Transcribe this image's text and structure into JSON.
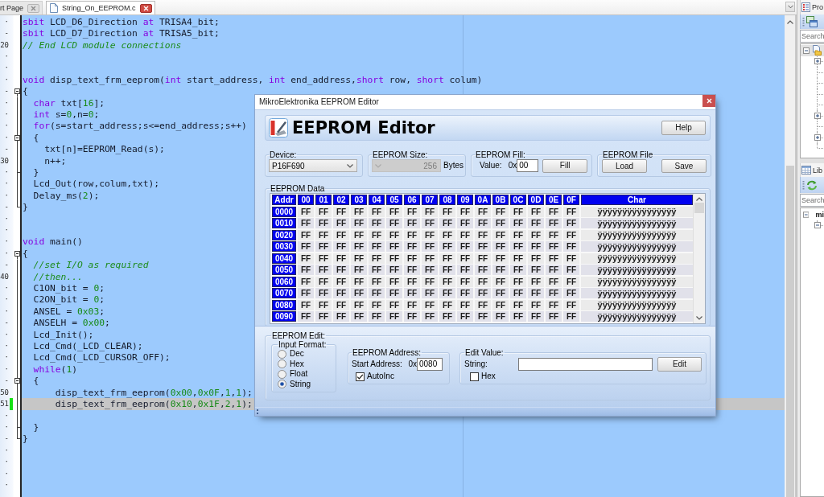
{
  "editor_tabs": [
    {
      "kind": "page",
      "label": "rt Page",
      "selected": false
    },
    {
      "kind": "file",
      "label": "String_On_EEPROM.c",
      "selected": true
    }
  ],
  "editor": {
    "lines": [
      {
        "kind": "plain",
        "gutter": "·",
        "current": false,
        "modified": false,
        "tokens": [
          {
            "kind": "keyword",
            "text": "sbit"
          },
          {
            "kind": "plain",
            "text": " LCD_D6_Direction "
          },
          {
            "kind": "keyword",
            "text": "at"
          },
          {
            "kind": "plain",
            "text": " TRISA4_bit;"
          }
        ]
      },
      {
        "kind": "plain",
        "gutter": "-",
        "current": false,
        "modified": false,
        "tokens": [
          {
            "kind": "keyword",
            "text": "sbit"
          },
          {
            "kind": "plain",
            "text": " LCD_D7_Direction "
          },
          {
            "kind": "keyword",
            "text": "at"
          },
          {
            "kind": "plain",
            "text": " TRISA5_bit;"
          }
        ]
      },
      {
        "kind": "plain",
        "gutter": "20",
        "current": false,
        "modified": false,
        "tokens": [
          {
            "kind": "comment",
            "text": "// End LCD module connections"
          }
        ]
      },
      {
        "kind": "plain",
        "gutter": "·",
        "current": false,
        "modified": false
      },
      {
        "kind": "plain",
        "gutter": "·",
        "current": false,
        "modified": false
      },
      {
        "kind": "plain",
        "gutter": "·",
        "current": false,
        "modified": false,
        "tokens": [
          {
            "kind": "keyword",
            "text": "void"
          },
          {
            "kind": "plain",
            "text": " disp_text_frm_eeprom("
          },
          {
            "kind": "keyword",
            "text": "int"
          },
          {
            "kind": "plain",
            "text": " start_address, "
          },
          {
            "kind": "keyword",
            "text": "int"
          },
          {
            "kind": "plain",
            "text": " end_address,"
          },
          {
            "kind": "keyword",
            "text": "short"
          },
          {
            "kind": "plain",
            "text": " row, "
          },
          {
            "kind": "keyword",
            "text": "short"
          },
          {
            "kind": "plain",
            "text": " colum)"
          }
        ]
      },
      {
        "kind": "fold_start",
        "gutter": "-",
        "current": false,
        "modified": false,
        "tokens": [
          {
            "kind": "plain",
            "text": "{"
          }
        ]
      },
      {
        "kind": "fold_body",
        "gutter": "·",
        "current": false,
        "modified": false,
        "tokens": [
          {
            "kind": "keyword",
            "text": "  char"
          },
          {
            "kind": "plain",
            "text": " txt["
          },
          {
            "kind": "number",
            "text": "16"
          },
          {
            "kind": "plain",
            "text": "];"
          }
        ]
      },
      {
        "kind": "fold_body",
        "gutter": "·",
        "current": false,
        "modified": false,
        "tokens": [
          {
            "kind": "keyword",
            "text": "  int"
          },
          {
            "kind": "plain",
            "text": " s="
          },
          {
            "kind": "number",
            "text": "0"
          },
          {
            "kind": "plain",
            "text": ",n="
          },
          {
            "kind": "number",
            "text": "0"
          },
          {
            "kind": "plain",
            "text": ";"
          }
        ]
      },
      {
        "kind": "fold_body",
        "gutter": "·",
        "current": false,
        "modified": false,
        "tokens": [
          {
            "kind": "keyword",
            "text": "  for"
          },
          {
            "kind": "plain",
            "text": "(s=start_address;s<=end_address;s++)"
          }
        ]
      },
      {
        "kind": "fold_start",
        "gutter": "·",
        "current": false,
        "modified": false,
        "tokens": [
          {
            "kind": "plain",
            "text": "  {"
          }
        ]
      },
      {
        "kind": "fold_body",
        "gutter": "-",
        "current": false,
        "modified": false,
        "tokens": [
          {
            "kind": "plain",
            "text": "    txt[n]=EEPROM_Read(s);"
          }
        ]
      },
      {
        "kind": "fold_body",
        "gutter": "30",
        "current": false,
        "modified": false,
        "tokens": [
          {
            "kind": "plain",
            "text": "    n++;"
          }
        ]
      },
      {
        "kind": "fold_branch",
        "gutter": "·",
        "current": false,
        "modified": false,
        "tokens": [
          {
            "kind": "plain",
            "text": "  }"
          }
        ]
      },
      {
        "kind": "fold_body",
        "gutter": "·",
        "current": false,
        "modified": false,
        "tokens": [
          {
            "kind": "plain",
            "text": "  Lcd_Out(row,colum,txt);"
          }
        ]
      },
      {
        "kind": "fold_body",
        "gutter": "·",
        "current": false,
        "modified": false,
        "tokens": [
          {
            "kind": "plain",
            "text": "  Delay_ms("
          },
          {
            "kind": "number",
            "text": "2"
          },
          {
            "kind": "plain",
            "text": ");"
          }
        ]
      },
      {
        "kind": "fold_end",
        "gutter": "-",
        "current": false,
        "modified": false,
        "tokens": [
          {
            "kind": "plain",
            "text": "}"
          }
        ]
      },
      {
        "kind": "plain",
        "gutter": "·",
        "current": false,
        "modified": false
      },
      {
        "kind": "plain",
        "gutter": "·",
        "current": false,
        "modified": false
      },
      {
        "kind": "plain",
        "gutter": "·",
        "current": false,
        "modified": false,
        "tokens": [
          {
            "kind": "keyword",
            "text": "void"
          },
          {
            "kind": "plain",
            "text": " main()"
          }
        ]
      },
      {
        "kind": "fold_start",
        "gutter": "·",
        "current": false,
        "modified": false,
        "tokens": [
          {
            "kind": "plain",
            "text": "{"
          }
        ]
      },
      {
        "kind": "fold_body",
        "gutter": "-",
        "current": false,
        "modified": false,
        "tokens": [
          {
            "kind": "comment",
            "text": "  //set I/O as required"
          }
        ]
      },
      {
        "kind": "fold_body",
        "gutter": "40",
        "current": false,
        "modified": false,
        "tokens": [
          {
            "kind": "comment",
            "text": "  //then..."
          }
        ]
      },
      {
        "kind": "fold_body",
        "gutter": "·",
        "current": false,
        "modified": false,
        "tokens": [
          {
            "kind": "plain",
            "text": "  C1ON_bit = "
          },
          {
            "kind": "number",
            "text": "0"
          },
          {
            "kind": "plain",
            "text": ";"
          }
        ]
      },
      {
        "kind": "fold_body",
        "gutter": "·",
        "current": false,
        "modified": false,
        "tokens": [
          {
            "kind": "plain",
            "text": "  C2ON_bit = "
          },
          {
            "kind": "number",
            "text": "0"
          },
          {
            "kind": "plain",
            "text": ";"
          }
        ]
      },
      {
        "kind": "fold_body",
        "gutter": "·",
        "current": false,
        "modified": false,
        "tokens": [
          {
            "kind": "plain",
            "text": "  ANSEL = "
          },
          {
            "kind": "number",
            "text": "0x03"
          },
          {
            "kind": "plain",
            "text": ";"
          }
        ]
      },
      {
        "kind": "fold_body",
        "gutter": "-",
        "current": false,
        "modified": false,
        "tokens": [
          {
            "kind": "plain",
            "text": "  ANSELH = "
          },
          {
            "kind": "number",
            "text": "0x00"
          },
          {
            "kind": "plain",
            "text": ";"
          }
        ]
      },
      {
        "kind": "fold_body",
        "gutter": "·",
        "current": false,
        "modified": false,
        "tokens": [
          {
            "kind": "plain",
            "text": "  Lcd_Init();"
          }
        ]
      },
      {
        "kind": "fold_body",
        "gutter": "·",
        "current": false,
        "modified": false,
        "tokens": [
          {
            "kind": "plain",
            "text": "  Lcd_Cmd(_LCD_CLEAR);"
          }
        ]
      },
      {
        "kind": "fold_body",
        "gutter": "·",
        "current": false,
        "modified": false,
        "tokens": [
          {
            "kind": "plain",
            "text": "  Lcd_Cmd(_LCD_CURSOR_OFF);"
          }
        ]
      },
      {
        "kind": "fold_body",
        "gutter": "·",
        "current": false,
        "modified": false,
        "tokens": [
          {
            "kind": "keyword",
            "text": "  while"
          },
          {
            "kind": "plain",
            "text": "("
          },
          {
            "kind": "number",
            "text": "1"
          },
          {
            "kind": "plain",
            "text": ")"
          }
        ]
      },
      {
        "kind": "fold_start",
        "gutter": "-",
        "current": false,
        "modified": false,
        "tokens": [
          {
            "kind": "plain",
            "text": "  {"
          }
        ]
      },
      {
        "kind": "fold_body",
        "gutter": "50",
        "current": false,
        "modified": false,
        "tokens": [
          {
            "kind": "plain",
            "text": "      disp_text_frm_eeprom("
          },
          {
            "kind": "number",
            "text": "0x00"
          },
          {
            "kind": "plain",
            "text": ","
          },
          {
            "kind": "number",
            "text": "0x0F"
          },
          {
            "kind": "plain",
            "text": ","
          },
          {
            "kind": "number",
            "text": "1"
          },
          {
            "kind": "plain",
            "text": ","
          },
          {
            "kind": "number",
            "text": "1"
          },
          {
            "kind": "plain",
            "text": ");"
          }
        ]
      },
      {
        "kind": "fold_body",
        "gutter": "51",
        "current": true,
        "modified": true,
        "tokens": [
          {
            "kind": "plain",
            "text": "      disp_text_frm_eeprom("
          },
          {
            "kind": "number",
            "text": "0x10"
          },
          {
            "kind": "plain",
            "text": ","
          },
          {
            "kind": "number",
            "text": "0x1F"
          },
          {
            "kind": "plain",
            "text": ","
          },
          {
            "kind": "number",
            "text": "2"
          },
          {
            "kind": "plain",
            "text": ","
          },
          {
            "kind": "number",
            "text": "1"
          },
          {
            "kind": "plain",
            "text": ");"
          }
        ]
      },
      {
        "kind": "fold_body",
        "gutter": "·",
        "current": false,
        "modified": false
      },
      {
        "kind": "fold_branch",
        "gutter": "·",
        "current": false,
        "modified": false,
        "tokens": [
          {
            "kind": "plain",
            "text": "  }"
          }
        ]
      },
      {
        "kind": "fold_end",
        "gutter": "-",
        "current": false,
        "modified": false,
        "tokens": [
          {
            "kind": "plain",
            "text": "}"
          }
        ]
      },
      {
        "kind": "plain",
        "gutter": "·",
        "current": false,
        "modified": false
      },
      {
        "kind": "plain",
        "gutter": "·",
        "current": false,
        "modified": false
      },
      {
        "kind": "plain",
        "gutter": "·",
        "current": false,
        "modified": false
      },
      {
        "kind": "plain",
        "gutter": "·",
        "current": false,
        "modified": false
      }
    ]
  },
  "eeprom_editor": {
    "title": "MikroElektronika EEPROM Editor",
    "heading": "EEPROM Editor",
    "help_button": "Help",
    "device": {
      "label": "Device:",
      "value": "P16F690"
    },
    "eeprom_size": {
      "label": "EEPROM Size:",
      "value": "256",
      "unit": "Bytes",
      "disabled": true
    },
    "eeprom_fill": {
      "label": "EEPROM Fill:",
      "value_label": "Value:",
      "prefix": "0x",
      "value": "00",
      "button": "Fill"
    },
    "eeprom_file": {
      "label": "EEPROM File",
      "buttons": [
        "Load",
        "Save"
      ]
    },
    "eeprom_data": {
      "label": "EEPROM Data",
      "columns": [
        "Addr",
        "00",
        "01",
        "02",
        "03",
        "04",
        "05",
        "06",
        "07",
        "08",
        "09",
        "0A",
        "0B",
        "0C",
        "0D",
        "0E",
        "0F",
        "Char"
      ],
      "rows": [
        {
          "cells": [
            "0000",
            "FF",
            "FF",
            "FF",
            "FF",
            "FF",
            "FF",
            "FF",
            "FF",
            "FF",
            "FF",
            "FF",
            "FF",
            "FF",
            "FF",
            "FF",
            "FF",
            "ÿÿÿÿÿÿÿÿÿÿÿÿÿÿÿÿ"
          ]
        },
        {
          "cells": [
            "0010",
            "FF",
            "FF",
            "FF",
            "FF",
            "FF",
            "FF",
            "FF",
            "FF",
            "FF",
            "FF",
            "FF",
            "FF",
            "FF",
            "FF",
            "FF",
            "FF",
            "ÿÿÿÿÿÿÿÿÿÿÿÿÿÿÿÿ"
          ]
        },
        {
          "cells": [
            "0020",
            "FF",
            "FF",
            "FF",
            "FF",
            "FF",
            "FF",
            "FF",
            "FF",
            "FF",
            "FF",
            "FF",
            "FF",
            "FF",
            "FF",
            "FF",
            "FF",
            "ÿÿÿÿÿÿÿÿÿÿÿÿÿÿÿÿ"
          ]
        },
        {
          "cells": [
            "0030",
            "FF",
            "FF",
            "FF",
            "FF",
            "FF",
            "FF",
            "FF",
            "FF",
            "FF",
            "FF",
            "FF",
            "FF",
            "FF",
            "FF",
            "FF",
            "FF",
            "ÿÿÿÿÿÿÿÿÿÿÿÿÿÿÿÿ"
          ]
        },
        {
          "cells": [
            "0040",
            "FF",
            "FF",
            "FF",
            "FF",
            "FF",
            "FF",
            "FF",
            "FF",
            "FF",
            "FF",
            "FF",
            "FF",
            "FF",
            "FF",
            "FF",
            "FF",
            "ÿÿÿÿÿÿÿÿÿÿÿÿÿÿÿÿ"
          ]
        },
        {
          "cells": [
            "0050",
            "FF",
            "FF",
            "FF",
            "FF",
            "FF",
            "FF",
            "FF",
            "FF",
            "FF",
            "FF",
            "FF",
            "FF",
            "FF",
            "FF",
            "FF",
            "FF",
            "ÿÿÿÿÿÿÿÿÿÿÿÿÿÿÿÿ"
          ]
        },
        {
          "cells": [
            "0060",
            "FF",
            "FF",
            "FF",
            "FF",
            "FF",
            "FF",
            "FF",
            "FF",
            "FF",
            "FF",
            "FF",
            "FF",
            "FF",
            "FF",
            "FF",
            "FF",
            "ÿÿÿÿÿÿÿÿÿÿÿÿÿÿÿÿ"
          ]
        },
        {
          "cells": [
            "0070",
            "FF",
            "FF",
            "FF",
            "FF",
            "FF",
            "FF",
            "FF",
            "FF",
            "FF",
            "FF",
            "FF",
            "FF",
            "FF",
            "FF",
            "FF",
            "FF",
            "ÿÿÿÿÿÿÿÿÿÿÿÿÿÿÿÿ"
          ]
        },
        {
          "cells": [
            "0080",
            "FF",
            "FF",
            "FF",
            "FF",
            "FF",
            "FF",
            "FF",
            "FF",
            "FF",
            "FF",
            "FF",
            "FF",
            "FF",
            "FF",
            "FF",
            "FF",
            "ÿÿÿÿÿÿÿÿÿÿÿÿÿÿÿÿ"
          ]
        },
        {
          "cells": [
            "0090",
            "FF",
            "FF",
            "FF",
            "FF",
            "FF",
            "FF",
            "FF",
            "FF",
            "FF",
            "FF",
            "FF",
            "FF",
            "FF",
            "FF",
            "FF",
            "FF",
            "ÿÿÿÿÿÿÿÿÿÿÿÿÿÿÿÿ"
          ]
        }
      ]
    },
    "eeprom_edit": {
      "label": "EEPROM Edit:",
      "input_format": {
        "label": "Input Format:",
        "options": [
          {
            "label": "Dec",
            "selected": false
          },
          {
            "label": "Hex",
            "selected": false
          },
          {
            "label": "Float",
            "selected": false
          },
          {
            "label": "String",
            "selected": true
          }
        ]
      },
      "eeprom_address": {
        "label": "EEPROM Address:",
        "start_address_label": "Start Address:",
        "prefix": "0x",
        "value": "0080",
        "auto_increment": {
          "label": "AutoInc",
          "checked": true
        }
      },
      "edit_value": {
        "label": "Edit Value:",
        "string_label": "String:",
        "button": "Edit",
        "hex": {
          "label": "Hex",
          "checked": false
        }
      }
    }
  },
  "project_manager": {
    "title": "Pro",
    "search": {
      "placeholder": "Search"
    },
    "tree": [
      {
        "kind": "project",
        "expanded": true,
        "selected": true,
        "children": [
          {
            "kind": "folder",
            "expanded": false,
            "selected": false
          },
          {
            "kind": "leaf",
            "selected": false
          },
          {
            "kind": "leaf",
            "selected": false
          },
          {
            "kind": "leaf",
            "selected": false
          },
          {
            "kind": "leaf",
            "selected": false
          },
          {
            "kind": "folder",
            "expanded": false,
            "selected": false
          },
          {
            "kind": "leaf",
            "selected": false
          },
          {
            "kind": "folder",
            "expanded": false,
            "selected": false
          },
          {
            "kind": "leaf",
            "selected": false
          }
        ]
      }
    ]
  },
  "library_manager": {
    "title": "Lib",
    "search": {
      "placeholder": "Search"
    },
    "tree": [
      {
        "kind": "folder",
        "label": "mi",
        "expanded": true,
        "selected": false,
        "children": [
          {
            "kind": "folder",
            "expanded": true,
            "selected": false
          }
        ]
      }
    ]
  }
}
